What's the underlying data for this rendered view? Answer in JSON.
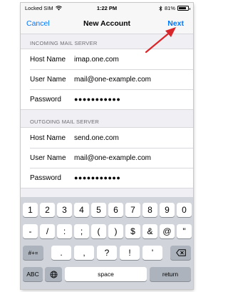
{
  "status_bar": {
    "carrier": "Locked SIM",
    "time": "1:22 PM",
    "battery_text": "81%",
    "battery_level": 0.81,
    "icons": [
      "wifi-icon",
      "bluetooth-icon",
      "battery-icon"
    ]
  },
  "nav": {
    "cancel_label": "Cancel",
    "title": "New Account",
    "next_label": "Next",
    "accent_color": "#0076ff"
  },
  "incoming": {
    "header": "INCOMING MAIL SERVER",
    "rows": [
      {
        "label": "Host Name",
        "value": "imap.one.com"
      },
      {
        "label": "User Name",
        "value": "mail@one-example.com"
      },
      {
        "label": "Password",
        "value": "●●●●●●●●●●●"
      }
    ]
  },
  "outgoing": {
    "header": "OUTGOING MAIL SERVER",
    "rows": [
      {
        "label": "Host Name",
        "value": "send.one.com"
      },
      {
        "label": "User Name",
        "value": "mail@one-example.com"
      },
      {
        "label": "Password",
        "value": "●●●●●●●●●●●"
      }
    ]
  },
  "keyboard": {
    "row1": [
      "1",
      "2",
      "3",
      "4",
      "5",
      "6",
      "7",
      "8",
      "9",
      "0"
    ],
    "row2": [
      "-",
      "/",
      ":",
      ";",
      "(",
      ")",
      "$",
      "&",
      "@",
      "\""
    ],
    "row3_mode": "#+=",
    "row3": [
      ".",
      ",",
      "?",
      "!",
      "'"
    ],
    "abc_label": "ABC",
    "space_label": "space",
    "return_label": "return",
    "icons": [
      "globe-icon",
      "backspace-icon"
    ]
  },
  "annotation": {
    "color": "#d9262a",
    "icon": "arrow-icon"
  }
}
